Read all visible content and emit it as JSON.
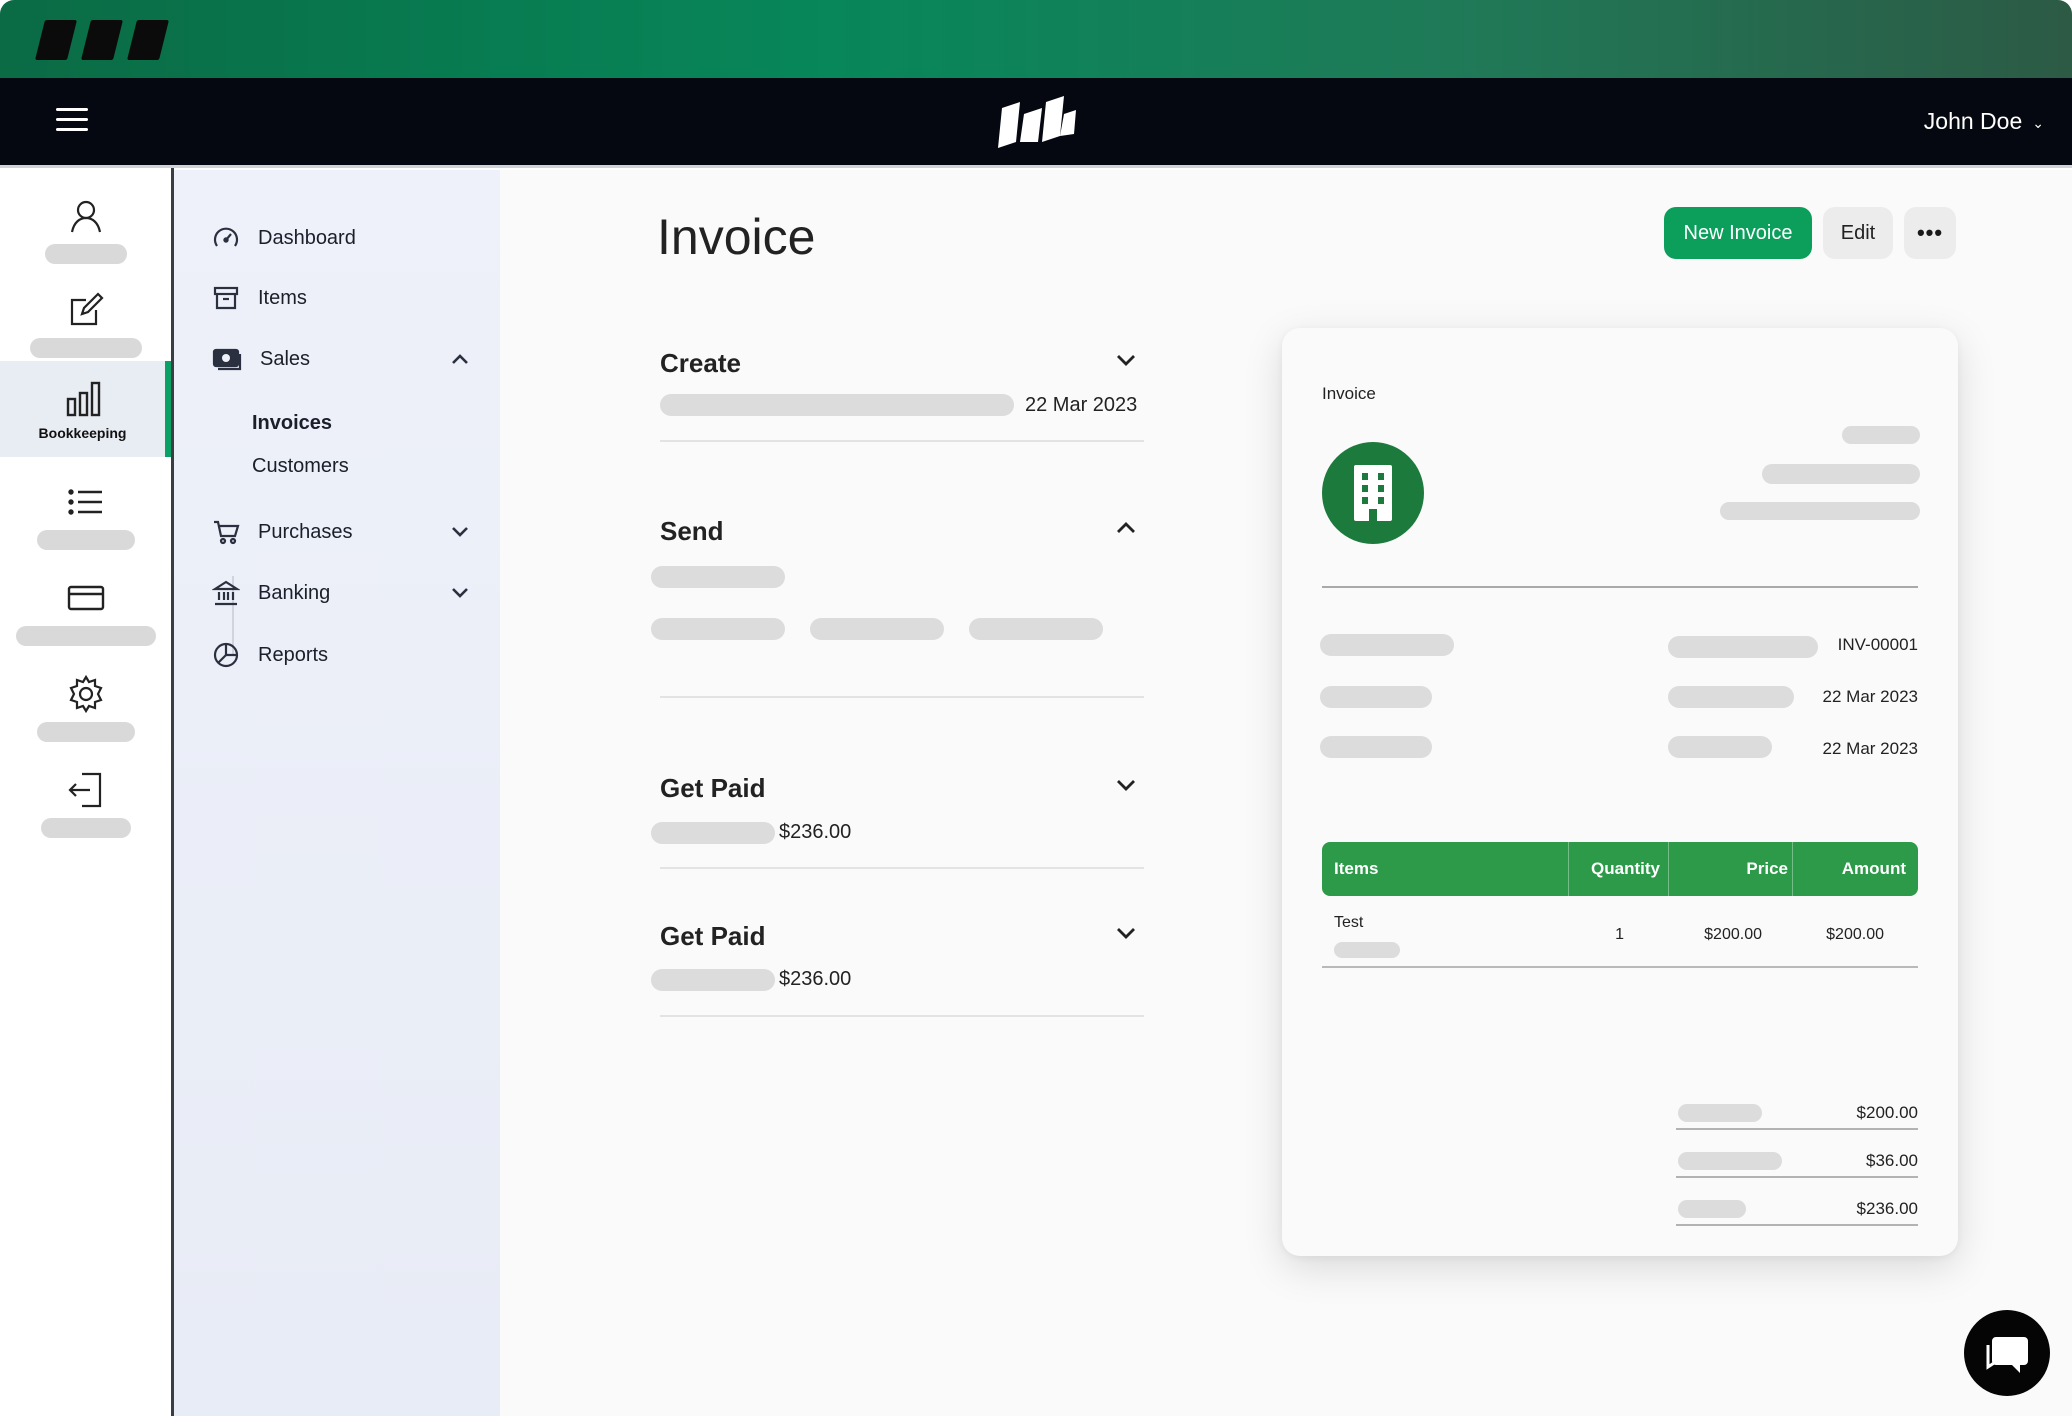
{
  "app": {
    "user_name": "John Doe"
  },
  "rail": {
    "active_label": "Bookkeeping"
  },
  "nav": {
    "dashboard": "Dashboard",
    "items": "Items",
    "sales": "Sales",
    "invoices": "Invoices",
    "customers": "Customers",
    "purchases": "Purchases",
    "banking": "Banking",
    "reports": "Reports"
  },
  "page": {
    "title": "Invoice",
    "new_invoice": "New Invoice",
    "edit": "Edit",
    "more": "•••"
  },
  "sections": {
    "create": {
      "title": "Create",
      "date": "22 Mar 2023"
    },
    "send": {
      "title": "Send"
    },
    "get_paid_1": {
      "title": "Get Paid",
      "amount": "$236.00"
    },
    "get_paid_2": {
      "title": "Get Paid",
      "amount": "$236.00"
    }
  },
  "invoice": {
    "label": "Invoice",
    "number": "INV-00001",
    "issue_date": "22 Mar 2023",
    "due_date": "22 Mar 2023",
    "table_headers": {
      "items": "Items",
      "quantity": "Quantity",
      "price": "Price",
      "amount": "Amount"
    },
    "rows": [
      {
        "item": "Test",
        "quantity": "1",
        "price": "$200.00",
        "amount": "$200.00"
      }
    ],
    "subtotal": "$200.00",
    "tax": "$36.00",
    "total": "$236.00"
  },
  "colors": {
    "accent": "#0c9f5c",
    "table_header": "#2c9a48",
    "logo": "#1b7a3c",
    "header_bg": "#050810"
  }
}
